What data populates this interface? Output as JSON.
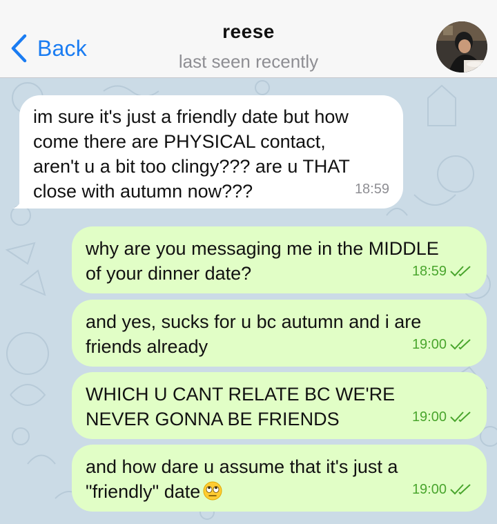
{
  "header": {
    "back_label": "Back",
    "contact_name": "reese",
    "contact_status": "last seen recently"
  },
  "messages": [
    {
      "direction": "incoming",
      "text": "im sure it's just a friendly date but how\ncome there are PHYSICAL contact,\naren't u a bit too clingy??? are u THAT\nclose with autumn now???",
      "time": "18:59"
    },
    {
      "direction": "outgoing",
      "text": "why are you messaging me in the MIDDLE\nof your dinner date?",
      "time": "18:59",
      "status": "read"
    },
    {
      "direction": "outgoing",
      "text": "and yes, sucks for u bc autumn and i are\nfriends already",
      "time": "19:00",
      "status": "read"
    },
    {
      "direction": "outgoing",
      "text": "WHICH U CANT RELATE BC WE'RE\nNEVER GONNA BE FRIENDS",
      "time": "19:00",
      "status": "read"
    },
    {
      "direction": "outgoing",
      "text": "and how dare u assume that it's just a\n\"friendly\" date",
      "emoji": "eye-roll-emoji",
      "time": "19:00",
      "status": "read"
    }
  ],
  "colors": {
    "accent": "#1a7cf2",
    "outgoing_bubble": "#e1fec6",
    "incoming_bubble": "#ffffff",
    "outgoing_time": "#49a52d",
    "wallpaper": "#cbdbe6"
  }
}
